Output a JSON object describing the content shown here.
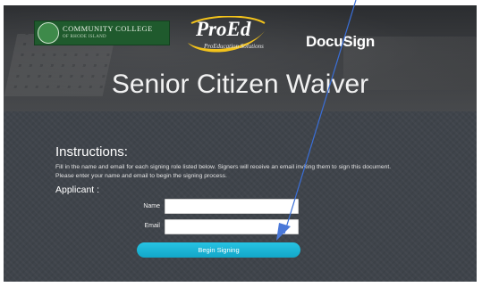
{
  "header": {
    "college_name": "COMMUNITY COLLEGE",
    "college_subname": "OF RHODE ISLAND",
    "proed_name": "ProEd",
    "proed_tagline": "ProEducation Solutions",
    "docusign": "DocuSign",
    "title": "Senior Citizen Waiver"
  },
  "instructions": {
    "heading": "Instructions:",
    "text": "Fill in the name and email for each signing role listed below. Signers will receive an email inviting them to sign this document. Please enter your name and email to begin the signing process.",
    "role_label": "Applicant :"
  },
  "form": {
    "name_label": "Name",
    "name_value": "",
    "email_label": "Email",
    "email_value": "",
    "begin_label": "Begin Signing"
  },
  "colors": {
    "accent_button": "#1bb5d8",
    "annotation_arrow": "#3a6fd8"
  }
}
